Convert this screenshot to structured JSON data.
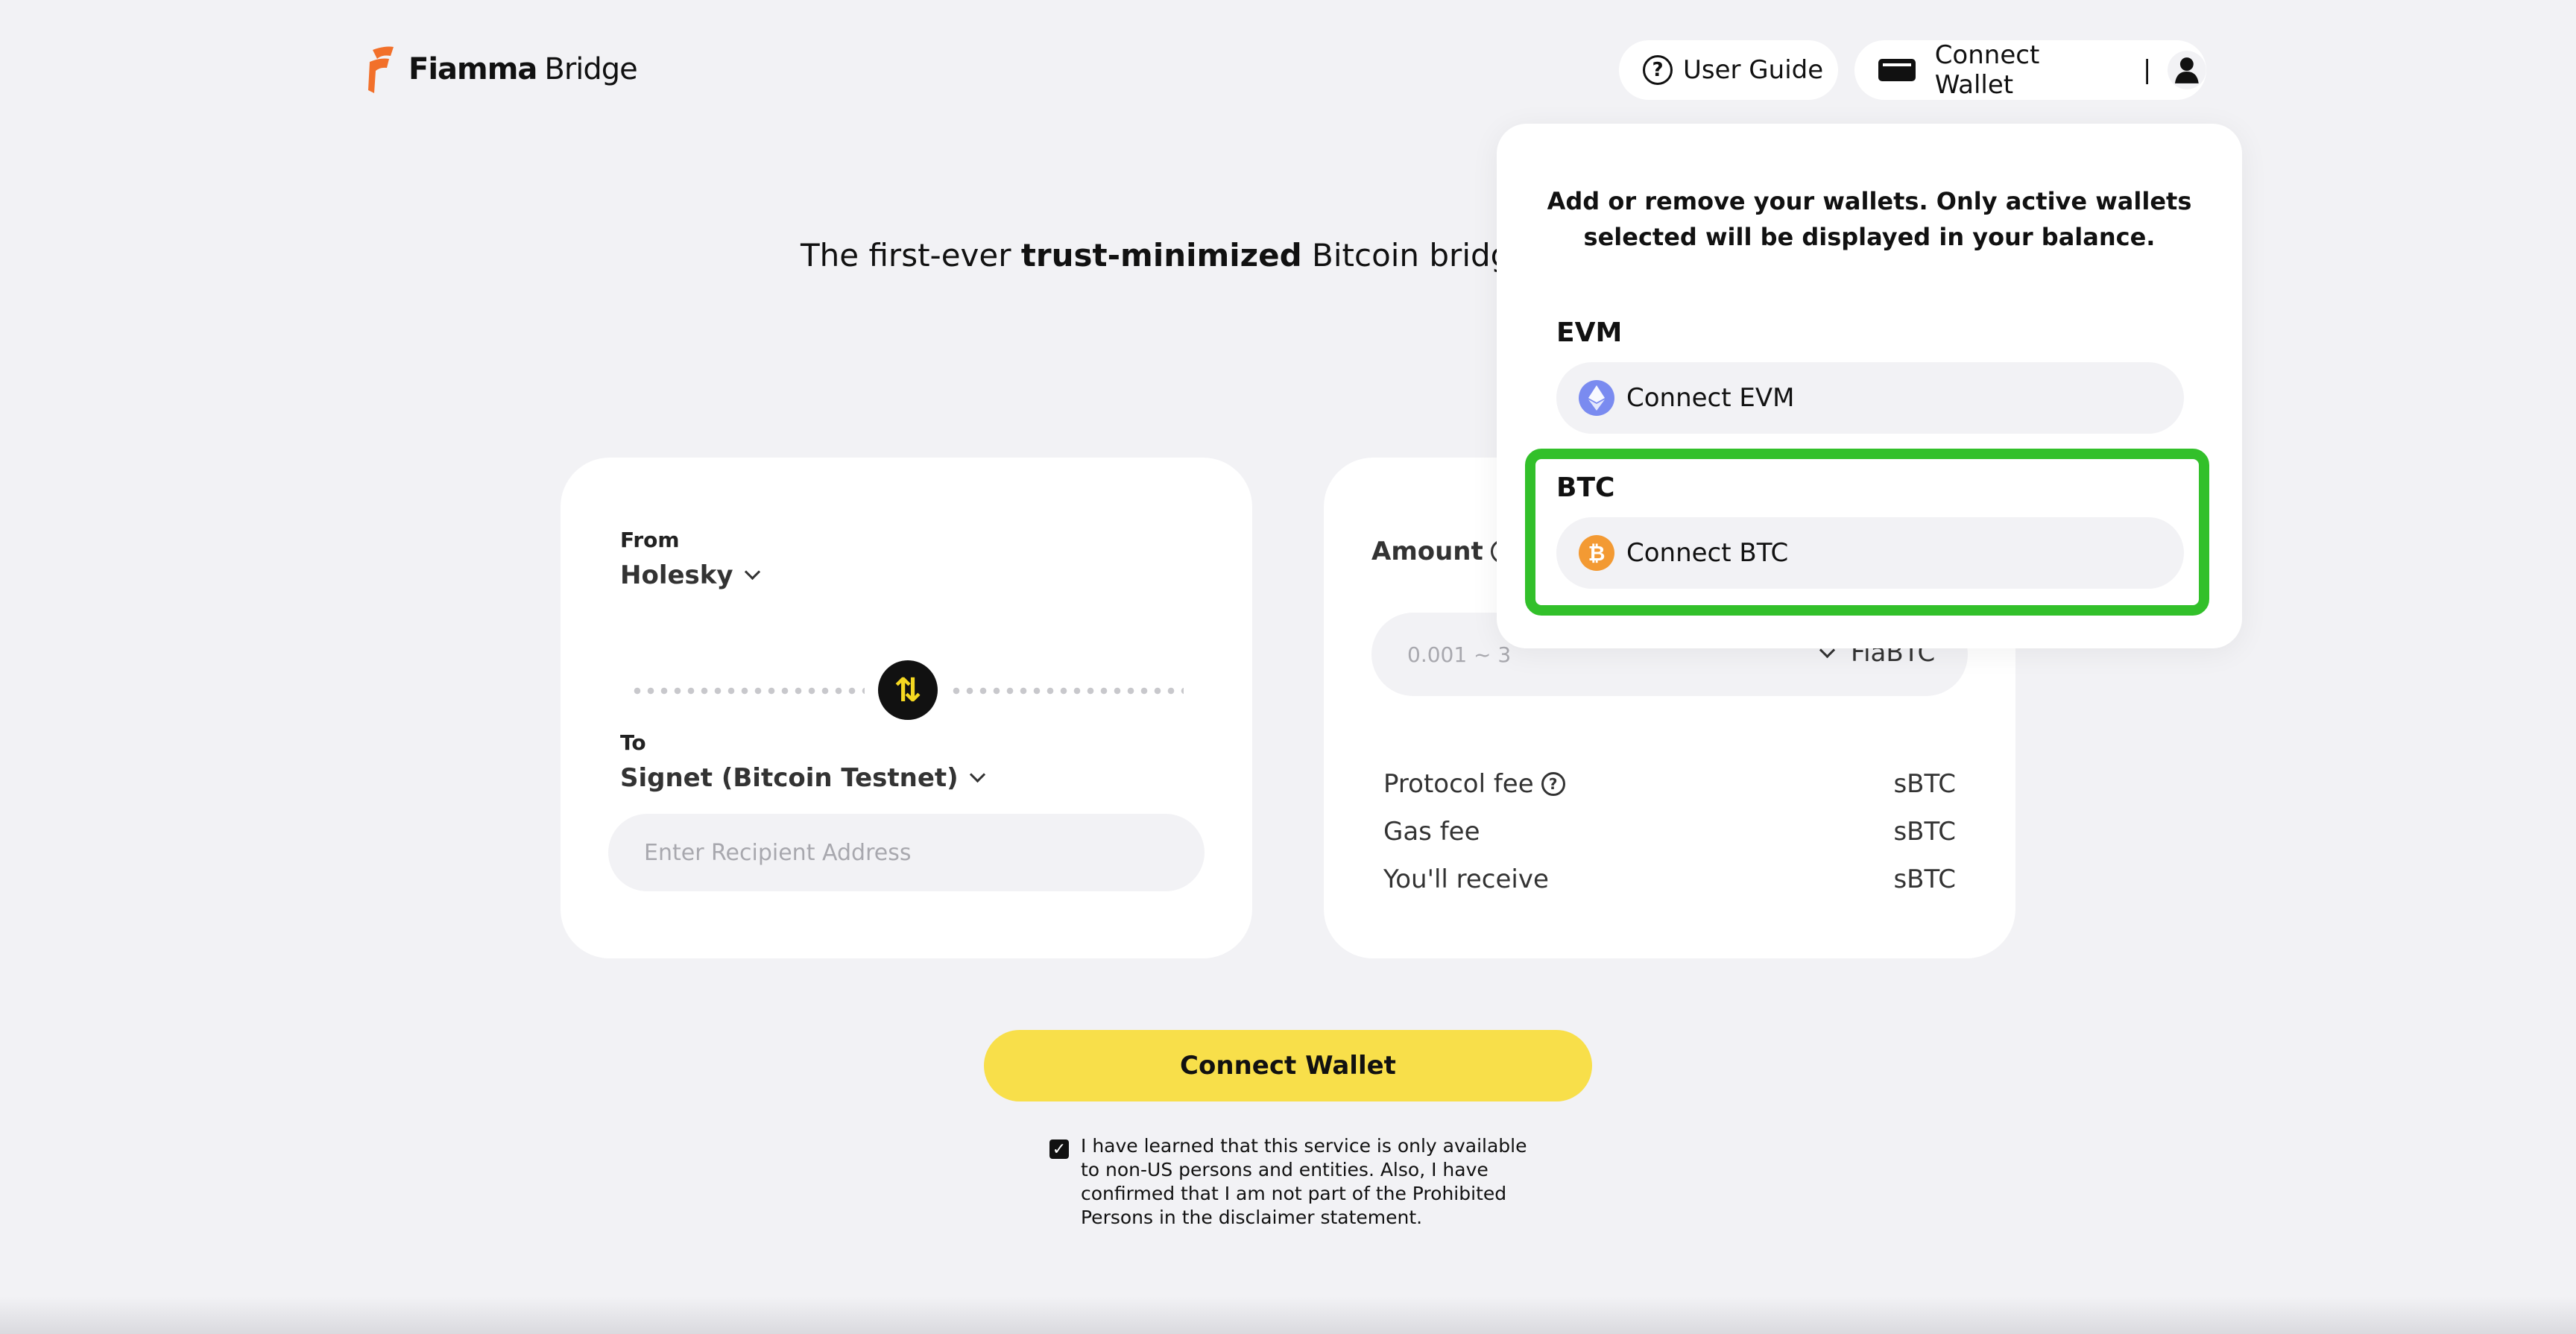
{
  "header": {
    "logo_name": "Fiamma",
    "logo_sub": "Bridge",
    "user_guide_label": "User Guide",
    "connect_wallet_label": "Connect Wallet",
    "divider": "|"
  },
  "hero": {
    "tagline_prefix": "The first-ever ",
    "tagline_bold": "trust-minimized",
    "tagline_suffix": " Bitcoin bridge p"
  },
  "bridge": {
    "from_label": "From",
    "from_network": "Holesky",
    "to_label": "To",
    "to_network": "Signet (Bitcoin Testnet)",
    "recipient_placeholder": "Enter Recipient Address"
  },
  "amount": {
    "label": "Amount",
    "placeholder": "0.001 ~ 3",
    "token": "FiaBTC"
  },
  "fees": [
    {
      "label": "Protocol fee",
      "value": "sBTC",
      "has_help": true
    },
    {
      "label": "Gas fee",
      "value": "sBTC",
      "has_help": false
    },
    {
      "label": "You'll receive",
      "value": "sBTC",
      "has_help": false
    }
  ],
  "cta": {
    "label": "Connect Wallet"
  },
  "disclaimer": {
    "checked": true,
    "text": "I have learned that this service is only available to non-US persons and entities. Also, I have confirmed that I am not part of the Prohibited Persons in the disclaimer statement."
  },
  "wallet_panel": {
    "title": "Add or remove your wallets. Only active wallets selected will be displayed in your balance.",
    "evm_label": "EVM",
    "evm_button": "Connect EVM",
    "btc_label": "BTC",
    "btc_button": "Connect BTC"
  },
  "icons": {
    "help": "question-circle-icon",
    "wallet": "wallet-icon",
    "user": "user-icon",
    "swap": "swap-arrows-icon",
    "eth": "ethereum-icon",
    "btc": "bitcoin-icon"
  },
  "colors": {
    "background": "#f2f2f5",
    "accent_yellow": "#f8df4a",
    "highlight_green": "#32c02a",
    "logo_orange": "#f2702a"
  }
}
